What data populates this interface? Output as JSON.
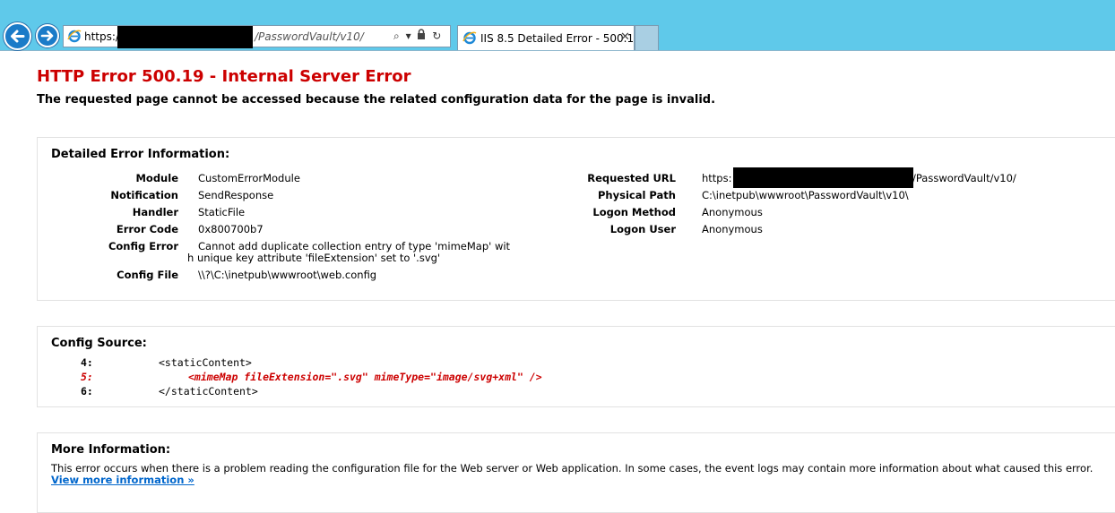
{
  "browser": {
    "address_prefix": "https://",
    "address_suffix": "/PasswordVault/v10/",
    "address_icons": {
      "search": "⌕",
      "dropdown": "▾",
      "lock": "🔒",
      "refresh": "↻"
    },
    "tab_title": "IIS 8.5 Detailed Error - 500.1...",
    "tab_close": "✕"
  },
  "page": {
    "title": "HTTP Error 500.19 - Internal Server Error",
    "subtitle": "The requested page cannot be accessed because the related configuration data for the page is invalid."
  },
  "detail": {
    "heading": "Detailed Error Information:",
    "left": [
      {
        "label": "Module",
        "value": "CustomErrorModule"
      },
      {
        "label": "Notification",
        "value": "SendResponse"
      },
      {
        "label": "Handler",
        "value": "StaticFile"
      },
      {
        "label": "Error Code",
        "value": "0x800700b7"
      },
      {
        "label": "Config Error",
        "value": "Cannot add duplicate collection entry of type 'mimeMap' wit",
        "value2": "h unique key attribute 'fileExtension' set to '.svg'"
      },
      {
        "label": "Config File",
        "value": "\\\\?\\C:\\inetpub\\wwwroot\\web.config"
      }
    ],
    "right": [
      {
        "label": "Requested URL",
        "value": "https:",
        "value_suffix": "/PasswordVault/v10/"
      },
      {
        "label": "Physical Path",
        "value": "C:\\inetpub\\wwwroot\\PasswordVault\\v10\\"
      },
      {
        "label": "Logon Method",
        "value": "Anonymous"
      },
      {
        "label": "Logon User",
        "value": "Anonymous"
      }
    ]
  },
  "source": {
    "heading": "Config Source:",
    "lines": [
      {
        "num": "4:",
        "code": "<staticContent>"
      },
      {
        "num": "5:",
        "code": "<mimeMap fileExtension=\".svg\" mimeType=\"image/svg+xml\" />"
      },
      {
        "num": "6:",
        "code": "</staticContent>"
      }
    ]
  },
  "more": {
    "heading": "More Information:",
    "text": "This error occurs when there is a problem reading the configuration file for the Web server or Web application. In some cases, the event logs may contain more information about what caused this error.",
    "link": "View more information »"
  }
}
